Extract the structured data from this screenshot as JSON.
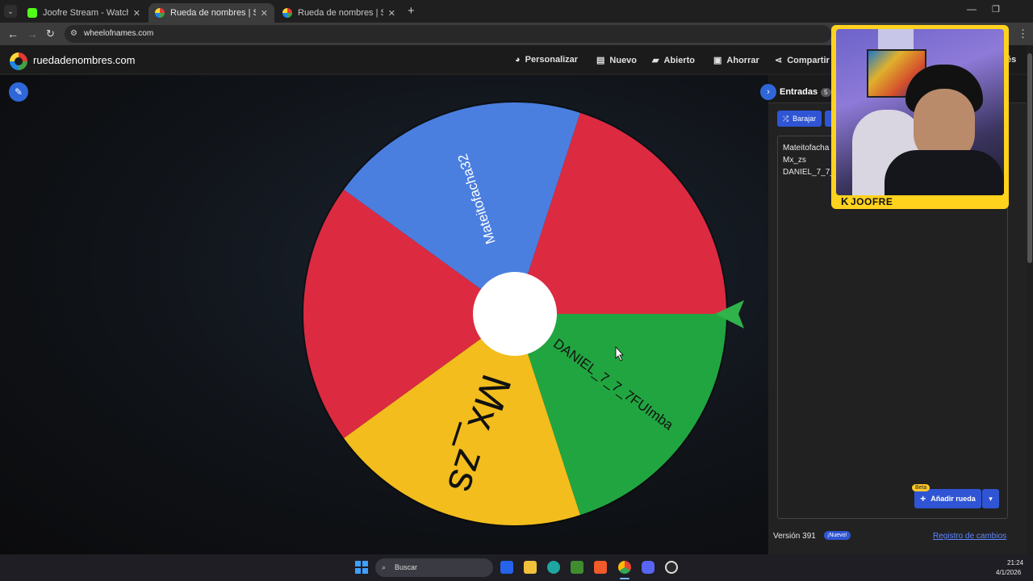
{
  "browser": {
    "tabs": [
      {
        "title": "Joofre Stream - Watch Live on K",
        "active": false,
        "favicon_color": "#53fc18"
      },
      {
        "title": "Rueda de nombres | Selector d",
        "active": true,
        "favicon_color": "#e53935"
      },
      {
        "title": "Rueda de nombres | Selector de",
        "active": false,
        "favicon_color": "#e53935"
      }
    ],
    "url": "wheelofnames.com"
  },
  "header": {
    "brand": "ruedadenombres.com",
    "menu": [
      {
        "label": "Personalizar",
        "icon": "palette-icon"
      },
      {
        "label": "Nuevo",
        "icon": "file-icon"
      },
      {
        "label": "Abierto",
        "icon": "folder-icon"
      },
      {
        "label": "Ahorrar",
        "icon": "save-icon"
      },
      {
        "label": "Compartir",
        "icon": "share-icon"
      }
    ],
    "language_fragment": "és"
  },
  "wheel": {
    "segments": [
      {
        "label": "Mateitofacha32",
        "color": "#4a7fe0"
      },
      {
        "label": "",
        "color": "#dc2b41"
      },
      {
        "label": "DANIEL_7_7_7FUImba",
        "color": "#21a540"
      },
      {
        "label": "Mx_zs",
        "color": "#f2bd1d"
      },
      {
        "label": "",
        "color": "#dc2b41"
      }
    ],
    "pointer_color": "#2fb34a"
  },
  "panel": {
    "title": "Entradas",
    "count": "5",
    "shuffle_label": "Barajar",
    "entries": [
      "Mateitofacha",
      "Mx_zs",
      "DANIEL_7_7_"
    ],
    "beta_label": "Beta",
    "add_wheel_label": "Añadir rueda",
    "version": "Versión 391",
    "new_badge": "¡Nuevo!",
    "changelog": "Registro de cambios"
  },
  "overlay": {
    "streamer": "JOOFRE",
    "logo_letter": "K",
    "frame_color": "#ffd21e"
  },
  "taskbar": {
    "search_label": "Buscar",
    "time": "21:24",
    "date": "4/1/2026"
  }
}
